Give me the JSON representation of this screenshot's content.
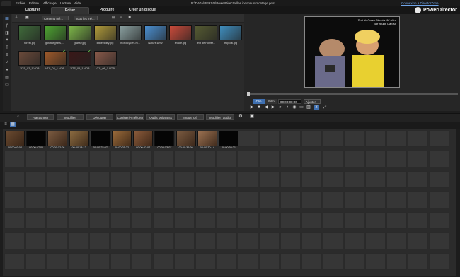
{
  "menu": [
    "Fichier",
    "Edition",
    "Affichage",
    "Lecture",
    "Aide"
  ],
  "title_path": "D:\\DATA\\PERSO\\PowerDirector\\les inconnus montage.pds*",
  "connexion_link": "Connexion à DirectorZone",
  "app_name": "PowerDirector",
  "modes": [
    "Capturer",
    "Editer",
    "Produire",
    "Créer un disque"
  ],
  "library": {
    "content_dropdown": "Contenu mé...",
    "filter_dropdown": "Tous les mé...",
    "items": [
      {
        "label": "forest.jpg",
        "color": "#3f6a3a"
      },
      {
        "label": "gotothegrass.j...",
        "color": "#4ea531"
      },
      {
        "label": "grassy.jpg",
        "color": "#7cb548"
      },
      {
        "label": "inthevalley.jpg",
        "color": "#b09a3a"
      },
      {
        "label": "motorcycles.m...",
        "color": "#8aa0a0"
      },
      {
        "label": "Nature.wmv",
        "color": "#4b8fd0"
      },
      {
        "label": "shade.jpg",
        "color": "#c94a3a"
      },
      {
        "label": "Text de Power...",
        "color": "#555a32"
      },
      {
        "label": "tropical.jpg",
        "color": "#3f8dbd"
      },
      {
        "label": "VTS_02_1.VOB",
        "color": "#6a4a3a"
      },
      {
        "label": "VTS_03_1.VOB",
        "color": "#a05a2a"
      },
      {
        "label": "VTS_05_1.VOB",
        "color": "#3a1818"
      },
      {
        "label": "VTS_06_1.VOB",
        "color": "#8a5a4a"
      }
    ]
  },
  "preview": {
    "watermark_line1": "Test de PowerDirector 12 Ultra",
    "watermark_line2": "par Bruno Caruso",
    "mode_clip": "Clip",
    "mode_film": "Film",
    "timecode": "00:00:00:00",
    "fit": "Ajuster"
  },
  "timeline_tools": [
    "Fractionner",
    "Modifier",
    "Découper",
    "Corriger/Améliorer",
    "Outils puissants",
    "Image clé",
    "Modifier l'audio"
  ],
  "clips": [
    {
      "time": "00:00:03:02",
      "color": "#6a4a30"
    },
    {
      "time": "00:00:47:01",
      "color": "#050505"
    },
    {
      "time": "00:00:12:08",
      "color": "#7a5a40"
    },
    {
      "time": "00:00:13:12",
      "color": "#8a6a40"
    },
    {
      "time": "00:00:22:07",
      "color": "#050505"
    },
    {
      "time": "00:00:25:22",
      "color": "#9a6a3a"
    },
    {
      "time": "00:00:32:07",
      "color": "#8a5a3a"
    },
    {
      "time": "00:00:13:07",
      "color": "#050505"
    },
    {
      "time": "00:00:36:20",
      "color": "#7a5a40"
    },
    {
      "time": "00:00:30:14",
      "color": "#9a7050"
    },
    {
      "time": "00:00:39:21",
      "color": "#050505"
    }
  ]
}
